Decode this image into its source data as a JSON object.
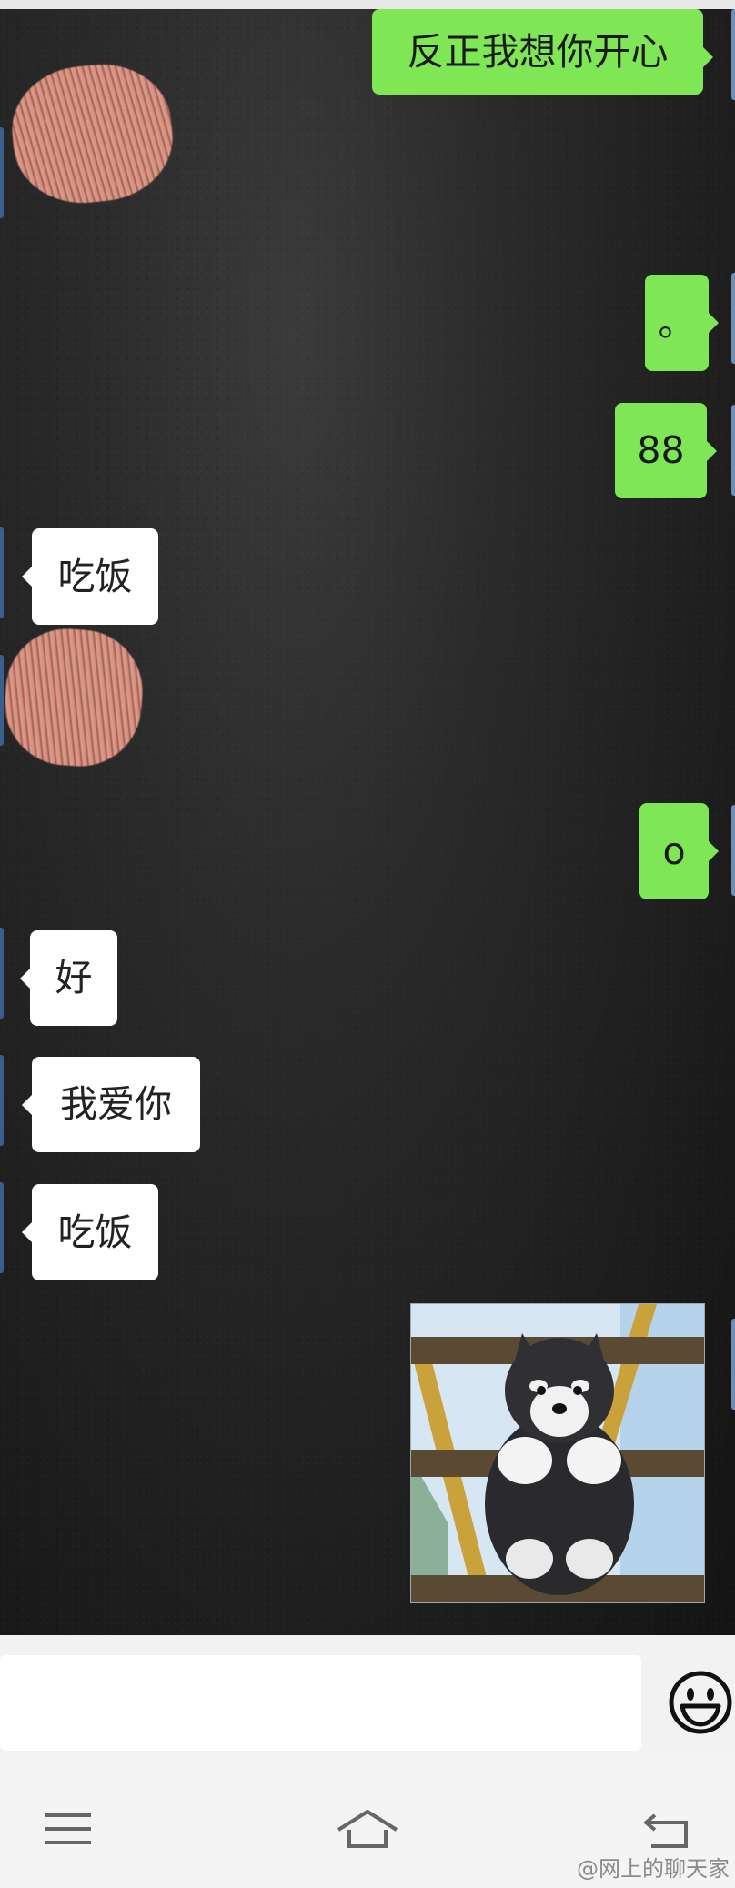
{
  "messages": [
    {
      "side": "out",
      "text": "反正我想你开心"
    },
    {
      "side": "out",
      "text": "。"
    },
    {
      "side": "out",
      "text": "88"
    },
    {
      "side": "in",
      "text": "吃饭"
    },
    {
      "side": "out",
      "text": "o"
    },
    {
      "side": "in",
      "text": "好"
    },
    {
      "side": "in",
      "text": "我爱你"
    },
    {
      "side": "in",
      "text": "吃饭"
    }
  ],
  "icons": {
    "emoji": "smiley-emoji-icon",
    "menu": "hamburger-menu-icon",
    "home": "home-icon",
    "back": "back-arrow-icon"
  },
  "colors": {
    "outgoing_bubble": "#7fe655",
    "incoming_bubble": "#ffffff",
    "chat_background": "#1f1f1f"
  },
  "watermark": "@网上的聊天家"
}
